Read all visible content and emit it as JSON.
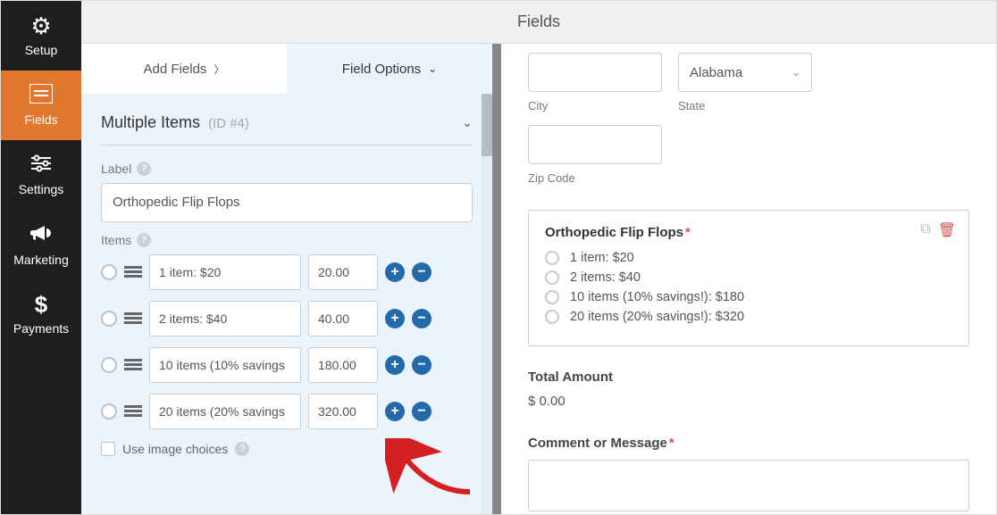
{
  "sidebar": {
    "items": [
      {
        "label": "Setup"
      },
      {
        "label": "Fields"
      },
      {
        "label": "Settings"
      },
      {
        "label": "Marketing"
      },
      {
        "label": "Payments"
      }
    ]
  },
  "topbar": {
    "title": "Fields"
  },
  "tabs": {
    "add": "Add Fields",
    "options": "Field Options"
  },
  "options_panel": {
    "section_title": "Multiple Items",
    "section_id_prefix": "(ID #",
    "section_id": "4",
    "section_id_suffix": ")",
    "label_caption": "Label",
    "label_value": "Orthopedic Flip Flops",
    "items_caption": "Items",
    "use_image_choices": "Use image choices",
    "items": [
      {
        "name": "1 item: $20",
        "price": "20.00"
      },
      {
        "name": "2 items: $40",
        "price": "40.00"
      },
      {
        "name": "10 items (10% savings",
        "price": "180.00"
      },
      {
        "name": "20 items (20% savings",
        "price": "320.00"
      }
    ]
  },
  "preview": {
    "city_label": "City",
    "state_label": "State",
    "state_value": "Alabama",
    "zip_label": "Zip Code",
    "field_title": "Orthopedic Flip Flops",
    "options": [
      "1 item: $20",
      "2 items: $40",
      "10 items (10% savings!): $180",
      "20 items (20% savings!): $320"
    ],
    "total_label": "Total Amount",
    "total_value": "$ 0.00",
    "comment_label": "Comment or Message"
  }
}
